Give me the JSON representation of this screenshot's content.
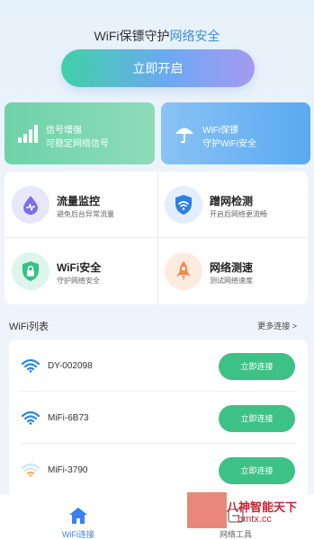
{
  "header": {
    "title_prefix": "WiFi保镖守护",
    "title_highlight": "网络安全"
  },
  "start_button": {
    "label": "立即开启"
  },
  "feature_cards": [
    {
      "title": "信号增强",
      "subtitle": "可稳定网络信号",
      "icon": "signal-bars-icon",
      "color": "#7fd8ae"
    },
    {
      "title": "WiFi保镖",
      "subtitle": "守护WiFi安全",
      "icon": "umbrella-icon",
      "color": "#6cb3f2"
    }
  ],
  "tools": [
    {
      "title": "流量监控",
      "subtitle": "避免后台异常流量",
      "icon": "traffic-drop-icon"
    },
    {
      "title": "蹭网检测",
      "subtitle": "开启后网络更流畅",
      "icon": "wifi-shield-icon"
    },
    {
      "title": "WiFi安全",
      "subtitle": "守护网络安全",
      "icon": "lock-shield-icon"
    },
    {
      "title": "网络测速",
      "subtitle": "测试网络速度",
      "icon": "rocket-icon"
    }
  ],
  "wifi_list": {
    "title": "WiFi列表",
    "more_label": "更多连接 >",
    "connect_label": "立即连接",
    "items": [
      {
        "name": "DY-002098",
        "signal": "strong"
      },
      {
        "name": "MiFi-6B73",
        "signal": "strong"
      },
      {
        "name": "MiFi-3790",
        "signal": "weak"
      }
    ]
  },
  "bottom_nav": [
    {
      "label": "WiFi连接",
      "icon": "home-icon",
      "active": true
    },
    {
      "label": "网络工具",
      "icon": "tools-icon",
      "active": false
    }
  ],
  "watermark": {
    "line1": "八神智能天下",
    "line2": "bmtx.cc"
  },
  "colors": {
    "accent_blue": "#3a8de0",
    "connect_green": "#3dc186",
    "active_tab": "#3a7ff0"
  }
}
